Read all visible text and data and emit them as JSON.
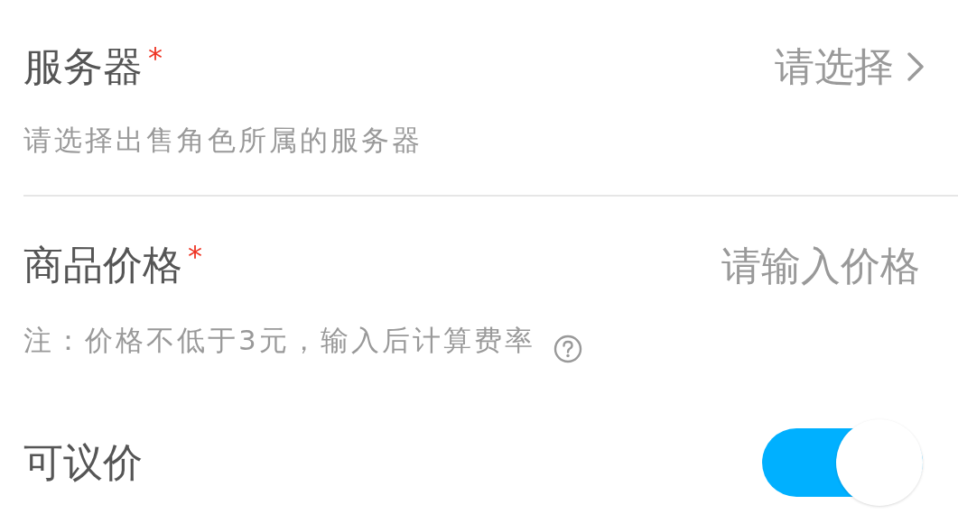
{
  "fields": [
    {
      "kind": "select",
      "label": "服务器",
      "required_mark": "*",
      "value_hint": "请选择",
      "hint": "请选择出售角色所属的服务器"
    },
    {
      "kind": "input",
      "label": "商品价格",
      "required_mark": "*",
      "placeholder": "请输入价格",
      "hint": "注：价格不低于3元，输入后计算费率"
    },
    {
      "kind": "switch",
      "label": "可议价",
      "on": true
    }
  ]
}
